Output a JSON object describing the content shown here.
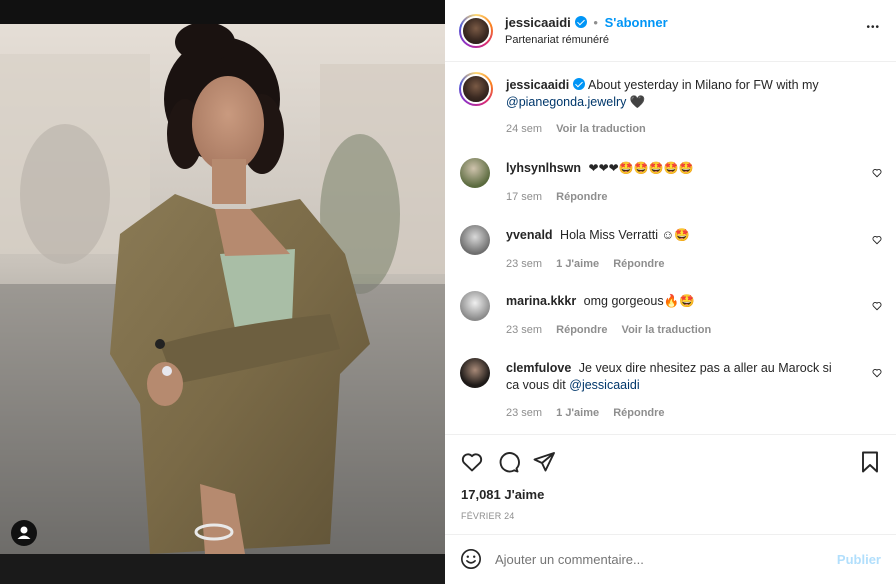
{
  "post": {
    "author": "jessicaaidi",
    "follow_label": "S'abonner",
    "separator": "•",
    "subtitle": "Partenariat rémunéré",
    "more": "•••"
  },
  "caption": {
    "user": "jessicaaidi",
    "text_before": "About yesterday in Milano for FW with my",
    "mention": "@pianegonda.jewelry",
    "emoji": "🖤",
    "time": "24 sem",
    "translate": "Voir la traduction"
  },
  "comments": [
    {
      "user": "lyhsynlhswn",
      "text": "❤❤❤🤩🤩🤩🤩🤩",
      "mention": "",
      "time": "17 sem",
      "likes": "",
      "reply": "Répondre",
      "translate": ""
    },
    {
      "user": "yvenald",
      "text": "Hola Miss Verratti ☺🤩",
      "mention": "",
      "time": "23 sem",
      "likes": "1 J'aime",
      "reply": "Répondre",
      "translate": ""
    },
    {
      "user": "marina.kkkr",
      "text": "omg gorgeous🔥🤩",
      "mention": "",
      "time": "23 sem",
      "likes": "",
      "reply": "Répondre",
      "translate": "Voir la traduction"
    },
    {
      "user": "clemfulove",
      "text": "Je veux dire nhesitez pas a aller au Marock si ca vous dit",
      "mention": "@jessicaaidi",
      "time": "23 sem",
      "likes": "1 J'aime",
      "reply": "Répondre",
      "translate": ""
    }
  ],
  "stats": {
    "likes": "17,081 J'aime",
    "date": "FÉVRIER 24"
  },
  "composer": {
    "placeholder": "Ajouter un commentaire...",
    "publish": "Publier"
  },
  "icons": {
    "like": "heart-icon",
    "comment": "comment-icon",
    "share": "share-icon",
    "save": "bookmark-icon",
    "emoji": "emoji-icon",
    "tagged": "user-tag-icon"
  },
  "colors": {
    "accent": "#0095f6",
    "muted": "#8e8e8e",
    "text": "#262626",
    "publish_disabled": "#b2dffc"
  }
}
